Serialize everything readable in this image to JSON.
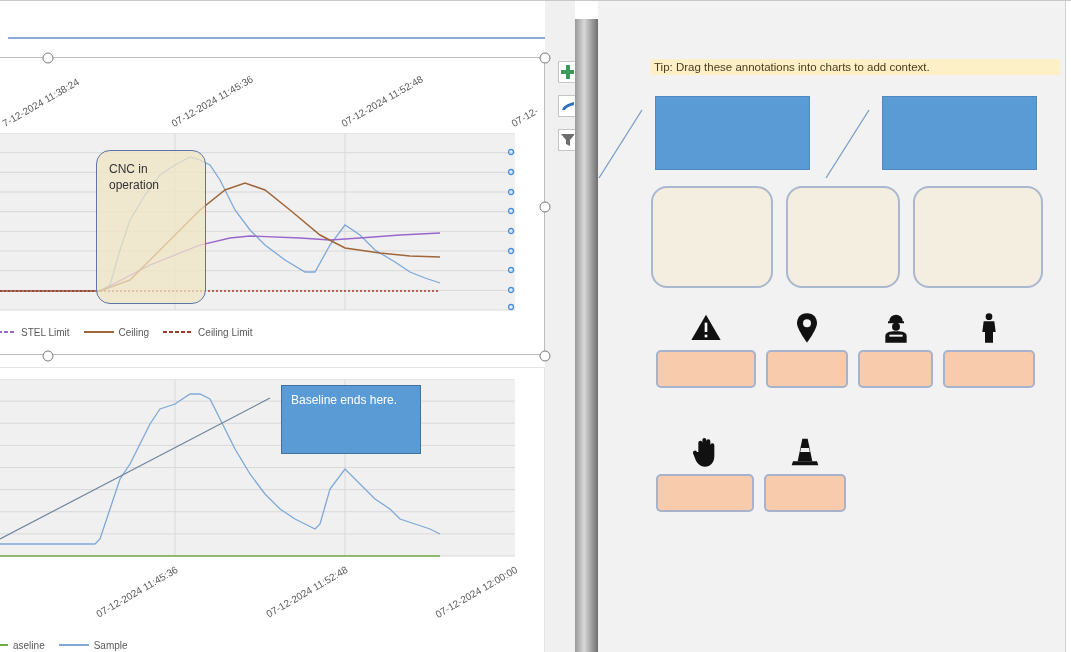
{
  "charts": [
    {
      "selected": true,
      "x_ticks": [
        "7-12-2024 11:38:24",
        "07-12-2024 11:45:36",
        "07-12-2024 11:52:48",
        "07-12-"
      ],
      "annotation": {
        "kind": "rounded",
        "text": "CNC in operation"
      },
      "legend": [
        {
          "label": "STEL Limit",
          "color": "#9966cc",
          "kind": "dotted"
        },
        {
          "label": "Ceiling",
          "color": "#a0663a",
          "kind": "solid"
        },
        {
          "label": "Ceiling Limit",
          "color": "#9b3b2a",
          "kind": "dotted"
        }
      ]
    },
    {
      "selected": false,
      "x_ticks": [
        "07-12-2024 11:45:36",
        "07-12-2024 11:52:48",
        "07-12-2024 12:00:00"
      ],
      "annotation": {
        "kind": "callout",
        "text": "Baseline ends here."
      },
      "legend": [
        {
          "label": "aseline",
          "color": "#70ad47",
          "kind": "solid"
        },
        {
          "label": "Sample",
          "color": "#7ea8d8",
          "kind": "solid"
        }
      ]
    }
  ],
  "tip": "Tip: Drag these annotations into charts to add context.",
  "icon_rows": [
    {
      "items": [
        {
          "kind": "warning"
        },
        {
          "kind": "pin"
        },
        {
          "kind": "worker"
        },
        {
          "kind": "person"
        }
      ]
    },
    {
      "items": [
        {
          "kind": "hand"
        },
        {
          "kind": "cone"
        }
      ]
    }
  ]
}
